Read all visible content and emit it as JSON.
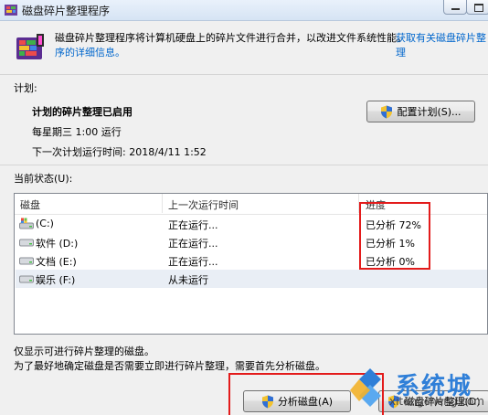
{
  "window": {
    "title": "磁盘碎片整理程序",
    "icon": "defrag-app-icon"
  },
  "intro": {
    "text": "磁盘碎片整理程序将计算机硬盘上的碎片文件进行合并，以改进文件系统性能。",
    "link_part1": "获取有关磁盘碎片整理",
    "link_part2": "序的详细信息。"
  },
  "schedule": {
    "section_label": "计划:",
    "status": "计划的碎片整理已启用",
    "frequency": "每星期三  1:00 运行",
    "next_run": "下一次计划运行时间: 2018/4/11 1:52",
    "configure_button": "配置计划(S)..."
  },
  "current_status": {
    "label": "当前状态(U):",
    "columns": [
      "磁盘",
      "上一次运行时间",
      "进度"
    ],
    "rows": [
      {
        "disk": "(C:)",
        "last_run": "正在运行...",
        "progress": "已分析 72%",
        "icon": "system-drive-icon"
      },
      {
        "disk": "软件 (D:)",
        "last_run": "正在运行...",
        "progress": "已分析 1%",
        "icon": "drive-icon"
      },
      {
        "disk": "文档 (E:)",
        "last_run": "正在运行...",
        "progress": "已分析 0%",
        "icon": "drive-icon"
      },
      {
        "disk": "娱乐 (F:)",
        "last_run": "从未运行",
        "progress": "",
        "icon": "drive-icon"
      }
    ]
  },
  "notes": {
    "line1": "仅显示可进行碎片整理的磁盘。",
    "line2": "为了最好地确定磁盘是否需要立即进行碎片整理，需要首先分析磁盘。"
  },
  "actions": {
    "analyze_button": "分析磁盘(A)",
    "defrag_button": "磁盘碎片整理(D)"
  },
  "watermark": {
    "text": "系统城",
    "url": "xitongcheng.com"
  },
  "colors": {
    "link": "#0066cc",
    "highlight": "#e31b1b",
    "selected_row": "#e9eef5"
  }
}
